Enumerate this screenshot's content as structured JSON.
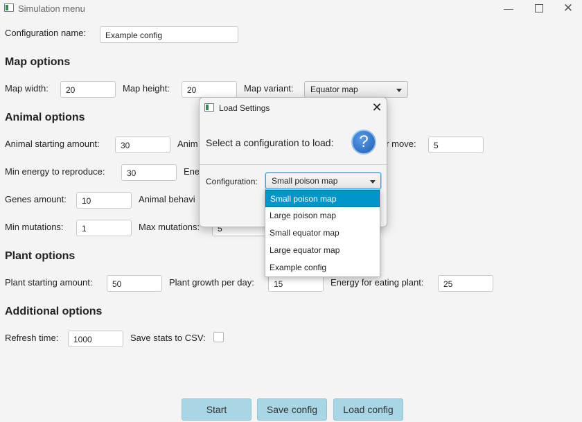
{
  "window": {
    "title": "Simulation menu"
  },
  "config_name": {
    "label": "Configuration name:",
    "value": "Example config"
  },
  "sections": {
    "map": "Map options",
    "animal": "Animal options",
    "plant": "Plant options",
    "additional": "Additional options"
  },
  "map": {
    "width_label": "Map width:",
    "width_value": "20",
    "height_label": "Map height:",
    "height_value": "20",
    "variant_label": "Map variant:",
    "variant_value": "Equator map"
  },
  "animal": {
    "start_label": "Animal starting amount:",
    "start_value": "30",
    "start_next_label": "Anim",
    "move_label": "er move:",
    "move_value": "5",
    "reproduce_label": "Min energy to reproduce:",
    "reproduce_value": "30",
    "reproduce_next_label": "Ene",
    "genes_label": "Genes amount:",
    "genes_value": "10",
    "behavior_label": "Animal behavi",
    "min_mut_label": "Min mutations:",
    "min_mut_value": "1",
    "max_mut_label": "Max mutations:",
    "max_mut_value": "5"
  },
  "plant": {
    "start_label": "Plant starting amount:",
    "start_value": "50",
    "growth_label": "Plant growth per day:",
    "growth_value": "15",
    "energy_label": "Energy for eating plant:",
    "energy_value": "25"
  },
  "additional": {
    "refresh_label": "Refresh time:",
    "refresh_value": "1000",
    "csv_label": "Save stats to CSV:",
    "csv_checked": false
  },
  "buttons": {
    "start": "Start",
    "save": "Save config",
    "load": "Load config"
  },
  "dialog": {
    "title": "Load Settings",
    "prompt": "Select a configuration to load:",
    "config_label": "Configuration:",
    "selected": "Small poison map",
    "options": [
      "Small poison map",
      "Large poison map",
      "Small equator map",
      "Large equator map",
      "Example config"
    ]
  }
}
